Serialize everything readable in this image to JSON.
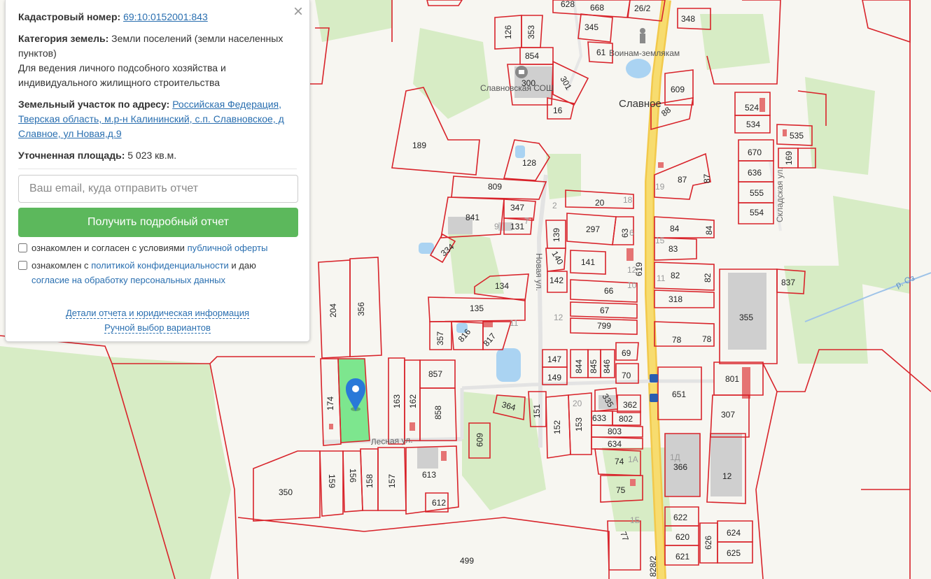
{
  "panel": {
    "cadastral_label": "Кадастровый номер:",
    "cadastral_number": "69:10:0152001:843",
    "category_label": "Категория земель:",
    "category_value": "Земли поселений (земли населенных пунктов)",
    "usage": "Для ведения личного подсобного хозяйства и индивидуального жилищного строительства",
    "address_label": "Земельный участок по адресу:",
    "address_value": "Российская Федерация, Тверская область, м.р-н Калининский, с.п. Славновское, д Славное, ул Новая,д.9",
    "area_label": "Уточненная площадь:",
    "area_value": "5 023 кв.м.",
    "email_placeholder": "Ваш email, куда отправить отчет",
    "button_label": "Получить подробный отчет",
    "consent1_text": "ознакомлен и согласен с условиями",
    "consent1_link": "публичной оферты",
    "consent2_text_a": "ознакомлен с",
    "consent2_link_a": "политикой конфиденциальности",
    "consent2_text_b": "и даю",
    "consent2_link_b": "согласие на обработку персональных данных",
    "link_details": "Детали отчета и юридическая информация",
    "link_manual": "Ручной выбор вариантов",
    "close_glyph": "×"
  },
  "map": {
    "parcel_color": "#d8232a",
    "selected_color": "#7de68e",
    "pin_color": "#2979d8",
    "place_name": "Славное",
    "school_label": "Славновская СОШ",
    "monument_label": "Воинам-землякам",
    "streets": {
      "novaya": "Новая ул.",
      "lesnaya": "Лесная ул.",
      "skladskaya": "Складская ул."
    },
    "road_labels": {
      "top": "619",
      "bottom": "828/2",
      "river": "р. Оз"
    },
    "labels": {
      "628": "628",
      "668": "668",
      "26_2": "26/2",
      "348": "348",
      "126": "126",
      "353": "353",
      "345": "345",
      "854": "854",
      "61": "61",
      "300": "300",
      "301": "301",
      "16": "16",
      "609": "609",
      "88": "88",
      "524": "524",
      "534": "534",
      "535": "535",
      "189": "189",
      "128": "128",
      "670": "670",
      "169": "169",
      "636": "636",
      "555": "555",
      "554": "554",
      "809": "809",
      "87a": "87",
      "87b": "87",
      "841": "841",
      "347": "347",
      "131": "131",
      "20": "20",
      "297": "297",
      "63": "63",
      "84a": "84",
      "84b": "84",
      "139": "139",
      "83": "83",
      "334": "334",
      "140": "140",
      "141": "141",
      "82a": "82",
      "82b": "82",
      "837": "837",
      "204": "204",
      "356": "356",
      "134": "134",
      "142": "142",
      "66": "66",
      "318": "318",
      "135": "135",
      "67": "67",
      "355": "355",
      "357": "357",
      "816": "816",
      "817": "817",
      "799": "799",
      "78a": "78",
      "78b": "78",
      "147": "147",
      "844": "844",
      "845": "845",
      "846": "846",
      "69": "69",
      "149": "149",
      "70": "70",
      "857": "857",
      "801": "801",
      "174": "174",
      "163": "163",
      "162": "162",
      "651": "651",
      "364": "364",
      "151": "151",
      "152": "152",
      "153": "153",
      "335": "335",
      "362": "362",
      "633": "633",
      "802": "802",
      "858": "858",
      "307": "307",
      "803": "803",
      "609b": "609",
      "634": "634",
      "74": "74",
      "366": "366",
      "12": "12",
      "350": "350",
      "159": "159",
      "156": "156",
      "158": "158",
      "157": "157",
      "613": "613",
      "612": "612",
      "75": "75",
      "622": "622",
      "620": "620",
      "626": "626",
      "624": "624",
      "77": "77",
      "621": "621",
      "625": "625",
      "499": "499"
    },
    "gray_labels": {
      "g2": "2",
      "g9": "9",
      "g7": "7",
      "g18": "18",
      "g6": "6",
      "g19": "19",
      "g15": "15",
      "g10": "10",
      "g11": "11",
      "g12": "12",
      "g11b": "11",
      "g20": "20",
      "g1a": "1A",
      "g1d": "1Д",
      "g1b": "1Б",
      "g4": "4"
    }
  }
}
